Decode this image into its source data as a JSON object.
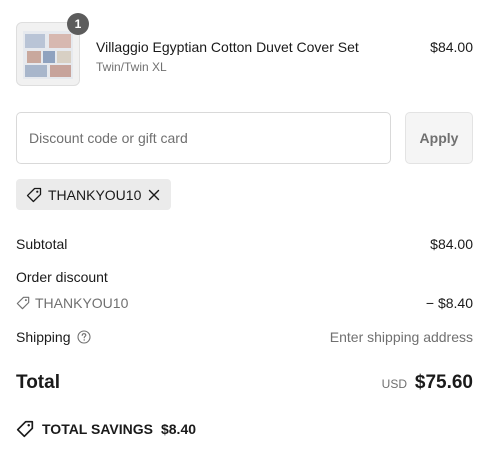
{
  "line_item": {
    "quantity": "1",
    "title": "Villaggio Egyptian Cotton Duvet Cover Set",
    "variant": "Twin/Twin XL",
    "price": "$84.00"
  },
  "discount": {
    "placeholder": "Discount code or gift card",
    "apply_label": "Apply",
    "applied_code": "THANKYOU10"
  },
  "summary": {
    "subtotal_label": "Subtotal",
    "subtotal_value": "$84.00",
    "order_discount_label": "Order discount",
    "discount_code": "THANKYOU10",
    "discount_value": "− $8.40",
    "shipping_label": "Shipping",
    "shipping_value": "Enter shipping address",
    "total_label": "Total",
    "currency": "USD",
    "total_value": "$75.60",
    "savings_label": "TOTAL SAVINGS",
    "savings_value": "$8.40"
  },
  "icons": {
    "tag": "tag-icon",
    "close": "close-icon",
    "info": "question-circle-icon"
  }
}
